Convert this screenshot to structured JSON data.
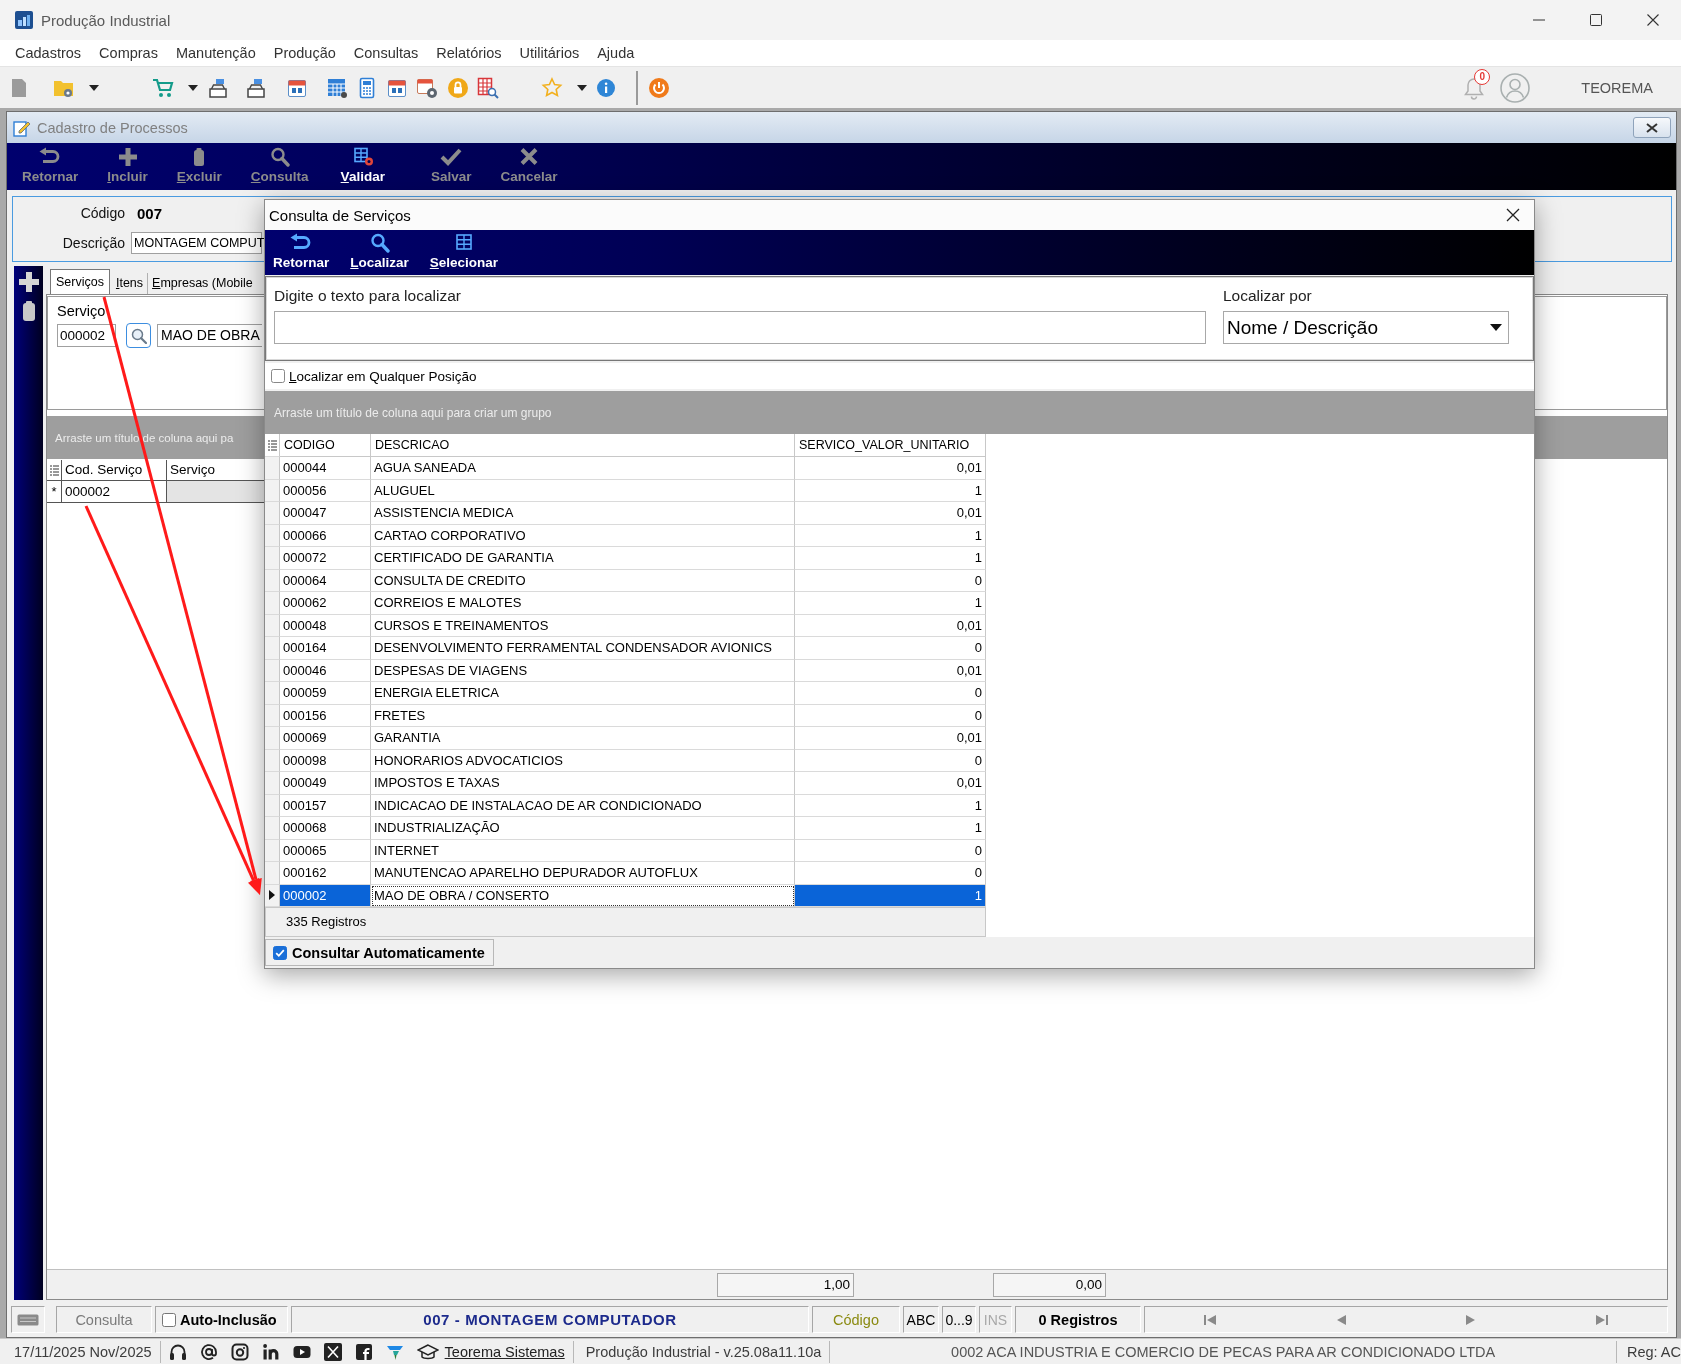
{
  "window": {
    "title": "Produção Industrial",
    "notifications": "0",
    "user": "TEOREMA"
  },
  "menu": [
    "Cadastros",
    "Compras",
    "Manutenção",
    "Produção",
    "Consultas",
    "Relatórios",
    "Utilitários",
    "Ajuda"
  ],
  "form": {
    "title": "Cadastro de Processos",
    "toolbar": [
      {
        "kind": "return",
        "label": "Retornar",
        "disabled": true,
        "access_key": false
      },
      {
        "kind": "add",
        "label": "Incluir",
        "disabled": true,
        "access_key": true
      },
      {
        "kind": "delete",
        "label": "Excluir",
        "disabled": true,
        "access_key": true
      },
      {
        "kind": "search",
        "label": "Consulta",
        "disabled": true,
        "access_key": true
      },
      {
        "kind": "validate",
        "label": "Validar",
        "disabled": false,
        "access_key": true
      },
      {
        "kind": "save",
        "label": "Salvar",
        "disabled": true,
        "access_key": false
      },
      {
        "kind": "cancel",
        "label": "Cancelar",
        "disabled": true,
        "access_key": false
      }
    ],
    "code": {
      "label": "Código",
      "value": "007"
    },
    "description": {
      "label": "Descrição",
      "value": "MONTAGEM COMPUT"
    },
    "tabs": [
      {
        "label": "Serviços",
        "selected": true,
        "access_key": false
      },
      {
        "label": "Itens",
        "selected": false,
        "access_key": true
      },
      {
        "label": "Empresas (Mobile",
        "selected": false,
        "access_key": true
      }
    ],
    "service": {
      "label": "Serviço",
      "code": "000002",
      "name": "MAO DE OBRA"
    },
    "group_hint": "Arraste um título de coluna aqui pa",
    "grid": {
      "columns": [
        "Cod. Serviço",
        "Serviço"
      ],
      "rows": [
        {
          "marker": "*",
          "code": "000002"
        }
      ]
    },
    "totals": [
      "1,00",
      "0,00"
    ],
    "status_bar": {
      "mode": "Consulta",
      "auto_insert": {
        "label": "Auto-Inclusão",
        "checked": false
      },
      "record": "007 - MONTAGEM COMPUTADOR",
      "index": "Código",
      "flags": [
        {
          "label": "ABC",
          "disabled": false
        },
        {
          "label": "0...9",
          "disabled": false
        },
        {
          "label": "INS",
          "disabled": true
        }
      ],
      "count": "0 Registros"
    }
  },
  "dialog": {
    "title": "Consulta de Serviços",
    "toolbar": [
      {
        "kind": "return",
        "label": "Retornar",
        "disabled": false,
        "access_key": false
      },
      {
        "kind": "search",
        "label": "Localizar",
        "disabled": false,
        "access_key": true
      },
      {
        "kind": "select",
        "label": "Selecionar",
        "disabled": false,
        "access_key": true
      }
    ],
    "search": {
      "label": "Digite o texto para localizar"
    },
    "search_by": {
      "label": "Localizar por",
      "value": "Nome / Descrição"
    },
    "any_position": {
      "label": "Localizar em Qualquer Posição",
      "checked": false,
      "access_key": true
    },
    "group_hint": "Arraste um título de coluna aqui para criar um grupo",
    "table": {
      "columns": [
        {
          "label": "CODIGO",
          "kind": "text",
          "focused": false
        },
        {
          "label": "DESCRICAO",
          "kind": "text",
          "focused": true
        },
        {
          "label": "SERVICO_VALOR_UNITARIO",
          "kind": "number",
          "focused": false
        }
      ],
      "rows": [
        {
          "cells": [
            "000044",
            "AGUA SANEADA",
            "0,01"
          ],
          "selected": false
        },
        {
          "cells": [
            "000056",
            "ALUGUEL",
            "1"
          ],
          "selected": false
        },
        {
          "cells": [
            "000047",
            "ASSISTENCIA MEDICA",
            "0,01"
          ],
          "selected": false
        },
        {
          "cells": [
            "000066",
            "CARTAO CORPORATIVO",
            "1"
          ],
          "selected": false
        },
        {
          "cells": [
            "000072",
            "CERTIFICADO DE GARANTIA",
            "1"
          ],
          "selected": false
        },
        {
          "cells": [
            "000064",
            "CONSULTA DE CREDITO",
            "0"
          ],
          "selected": false
        },
        {
          "cells": [
            "000062",
            "CORREIOS E MALOTES",
            "1"
          ],
          "selected": false
        },
        {
          "cells": [
            "000048",
            "CURSOS E TREINAMENTOS",
            "0,01"
          ],
          "selected": false
        },
        {
          "cells": [
            "000164",
            "DESENVOLVIMENTO FERRAMENTAL CONDENSADOR AVIONICS",
            "0"
          ],
          "selected": false
        },
        {
          "cells": [
            "000046",
            "DESPESAS DE VIAGENS",
            "0,01"
          ],
          "selected": false
        },
        {
          "cells": [
            "000059",
            "ENERGIA ELETRICA",
            "0"
          ],
          "selected": false
        },
        {
          "cells": [
            "000156",
            "FRETES",
            "0"
          ],
          "selected": false
        },
        {
          "cells": [
            "000069",
            "GARANTIA",
            "0,01"
          ],
          "selected": false
        },
        {
          "cells": [
            "000098",
            "HONORARIOS ADVOCATICIOS",
            "0"
          ],
          "selected": false
        },
        {
          "cells": [
            "000049",
            "IMPOSTOS E TAXAS",
            "0,01"
          ],
          "selected": false
        },
        {
          "cells": [
            "000157",
            "INDICACAO DE INSTALACAO DE AR CONDICIONADO",
            "1"
          ],
          "selected": false
        },
        {
          "cells": [
            "000068",
            "INDUSTRIALIZAÇÃO",
            "1"
          ],
          "selected": false
        },
        {
          "cells": [
            "000065",
            "INTERNET",
            "0"
          ],
          "selected": false
        },
        {
          "cells": [
            "000162",
            "MANUTENCAO APARELHO DEPURADOR AUTOFLUX",
            "0"
          ],
          "selected": false
        },
        {
          "cells": [
            "000002",
            "MAO DE OBRA / CONSERTO",
            "1"
          ],
          "selected": true
        }
      ],
      "footer": "335 Registros"
    },
    "auto_query": {
      "label": "Consultar Automaticamente",
      "checked": true
    }
  },
  "footer": {
    "date": "17/11/2025 Nov/2025",
    "link": "Teorema Sistemas",
    "version": "Produção Industrial - v.25.08a11.10a",
    "company": "0002 ACA INDUSTRIA E COMERCIO DE PECAS PARA AR CONDICIONADO LTDA",
    "registry": "Reg: AC"
  }
}
